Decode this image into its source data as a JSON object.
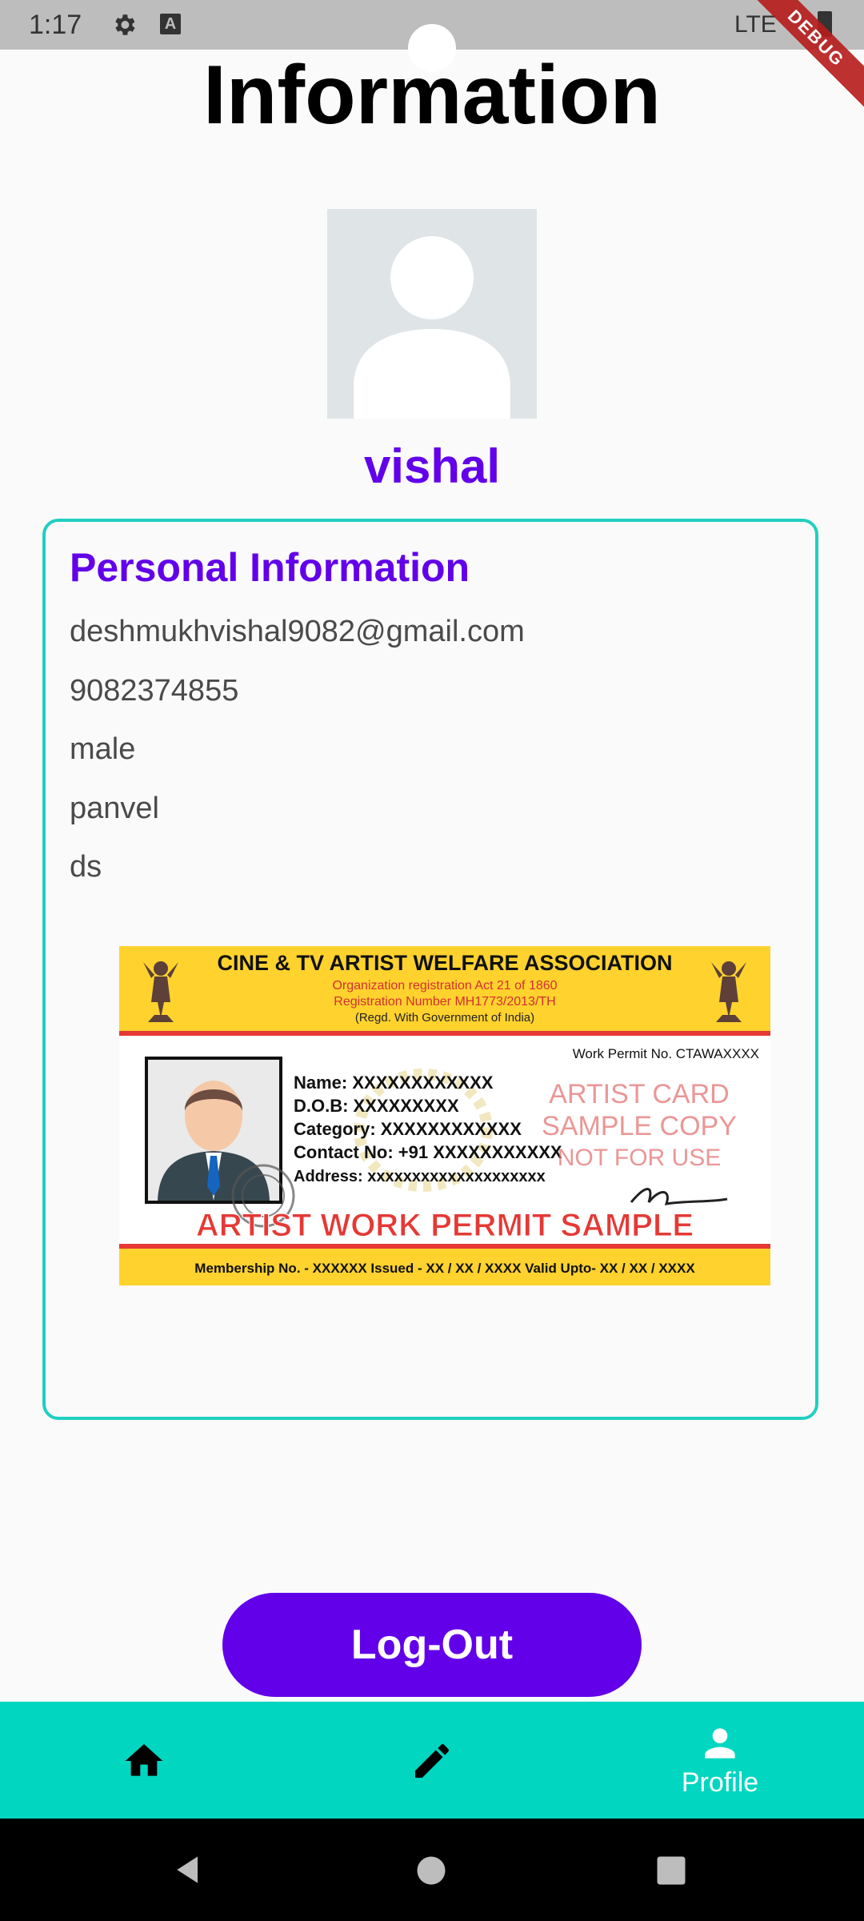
{
  "status_bar": {
    "time": "1:17",
    "network": "LTE"
  },
  "debug_banner": "DEBUG",
  "page": {
    "title": "Information"
  },
  "profile": {
    "name": "vishal"
  },
  "personal_info": {
    "heading": "Personal Information",
    "email": "deshmukhvishal9082@gmail.com",
    "phone": "9082374855",
    "gender": "male",
    "city": "panvel",
    "extra": "ds"
  },
  "permit_card": {
    "association": "CINE & TV ARTIST WELFARE ASSOCIATION",
    "reg_line1": "Organization registration Act 21 of 1860",
    "reg_line2": "Registration Number MH1773/2013/TH",
    "reg_line3": "(Regd. With Government of India)",
    "work_permit_no": "Work Permit No. CTAWAXXXX",
    "name_line": "Name: XXXXXXXXXXXX",
    "dob_line": "D.O.B: XXXXXXXXX",
    "category_line": "Category: XXXXXXXXXXXX",
    "contact_line": "Contact No: +91 XXXXXXXXXXX",
    "address_line": "Address: xxxxxxxxxxxxxxxxxxxx",
    "watermark1": "ARTIST CARD",
    "watermark2": "SAMPLE COPY",
    "watermark3": "NOT FOR USE",
    "banner": "ARTIST WORK PERMIT SAMPLE",
    "footer": "Membership No. - XXXXXX Issued - XX / XX / XXXX  Valid Upto- XX / XX / XXXX"
  },
  "actions": {
    "logout_label": "Log-Out"
  },
  "bottom_nav": {
    "profile_label": "Profile"
  },
  "colors": {
    "accent": "#6200ea",
    "teal": "#00d6c0",
    "card_border": "#20cfc2"
  }
}
